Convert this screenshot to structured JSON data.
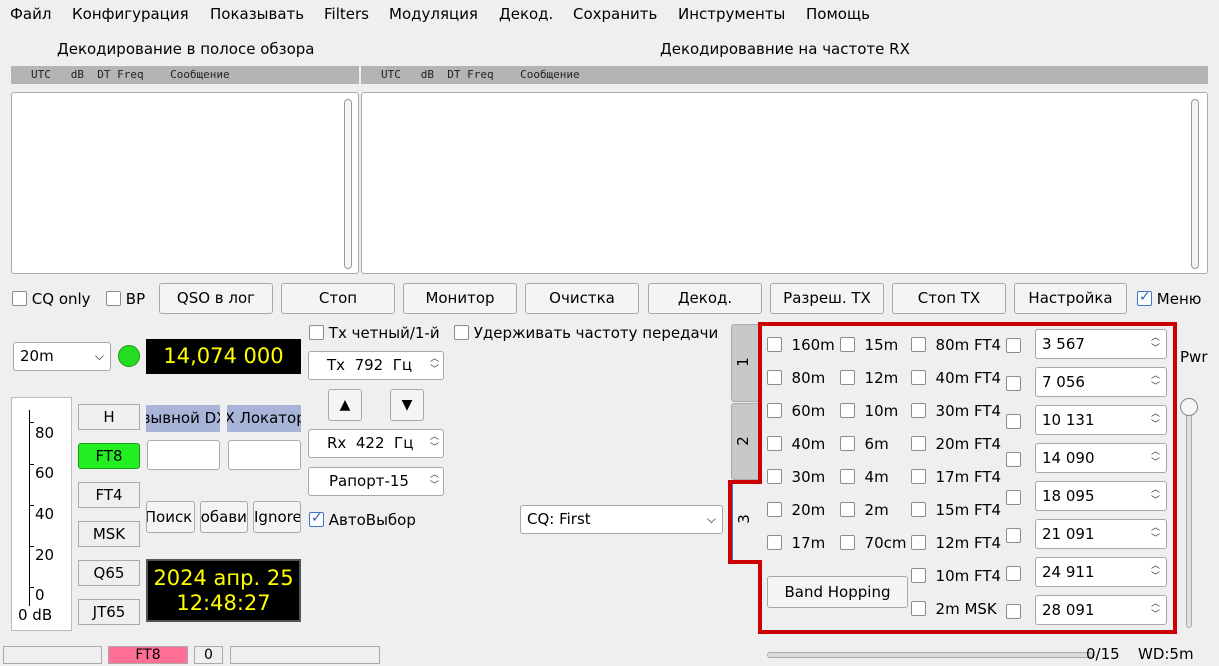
{
  "menu": [
    "Файл",
    "Конфигурация",
    "Показывать",
    "Filters",
    "Модуляция",
    "Декод.",
    "Сохранить",
    "Инструменты",
    "Помощь"
  ],
  "left_pane": {
    "title": "Декодирование в полосе обзора",
    "header": "UTC   dB  DT Freq    Сообщение"
  },
  "right_pane": {
    "title": "Декодировавние на частоте RX",
    "header": "UTC   dB  DT Freq    Сообщение"
  },
  "controls_row": {
    "cq_only": "CQ only",
    "bp": "BP",
    "qso_log": "QSO в лог",
    "stop": "Стоп",
    "monitor": "Монитор",
    "clear": "Очистка",
    "decode": "Декод.",
    "enable_tx": "Разреш. TX",
    "stop_tx": "Стоп TX",
    "settings": "Настройка",
    "menu": "Меню"
  },
  "band_select": "20m",
  "dial_freq": "14,074 000",
  "tx_even": "Tx четный/1-й",
  "hold_tx_freq": "Удерживать частоту передачи",
  "tx_spin": {
    "prefix": "Tx",
    "value": "792",
    "unit": "Гц"
  },
  "rx_spin": {
    "prefix": "Rx",
    "value": "422",
    "unit": "Гц"
  },
  "report": "Рапорт-15",
  "auto_select": "АвтоВыбор",
  "cq_combo": "CQ: First",
  "meter": {
    "ticks": [
      "80",
      "60",
      "40",
      "20",
      "0"
    ],
    "unit": "0 dB"
  },
  "mode_buttons": [
    "H",
    "FT8",
    "FT4",
    "MSK",
    "Q65",
    "JT65"
  ],
  "active_mode_color": "#22ee22",
  "dx_call_header": "Позывной DX",
  "dx_grid_header": "DX Локатор",
  "lookup": "Поиск",
  "add": "Добавить",
  "ignore": "Ignore",
  "clock": {
    "date": "2024 апр. 25",
    "time": "12:48:27"
  },
  "tabs": [
    "1",
    "2",
    "3"
  ],
  "bands": {
    "col1": [
      "160m",
      "80m",
      "60m",
      "40m",
      "30m",
      "20m",
      "17m"
    ],
    "col2": [
      "15m",
      "12m",
      "10m",
      "6m",
      "4m",
      "2m",
      "70cm"
    ],
    "col3": [
      "80m FT4",
      "40m FT4",
      "30m FT4",
      "20m FT4",
      "17m FT4",
      "15m FT4",
      "12m FT4",
      "10m FT4",
      "2m MSK"
    ],
    "freqs": [
      "3 567",
      "7 056",
      "10 131",
      "14 090",
      "18 095",
      "21 091",
      "24 911",
      "28 091"
    ]
  },
  "band_hopping": "Band Hopping",
  "pwr": "Pwr",
  "status": {
    "mode": "FT8",
    "count": "0",
    "progress": "0/15",
    "wd": "WD:5m"
  },
  "colors": {
    "highlight_border": "#cc0000",
    "dial_bg": "#000000",
    "dial_fg": "#ffff00",
    "mode_status": "#ff6f95",
    "header_blue": "#a8b4d8"
  }
}
